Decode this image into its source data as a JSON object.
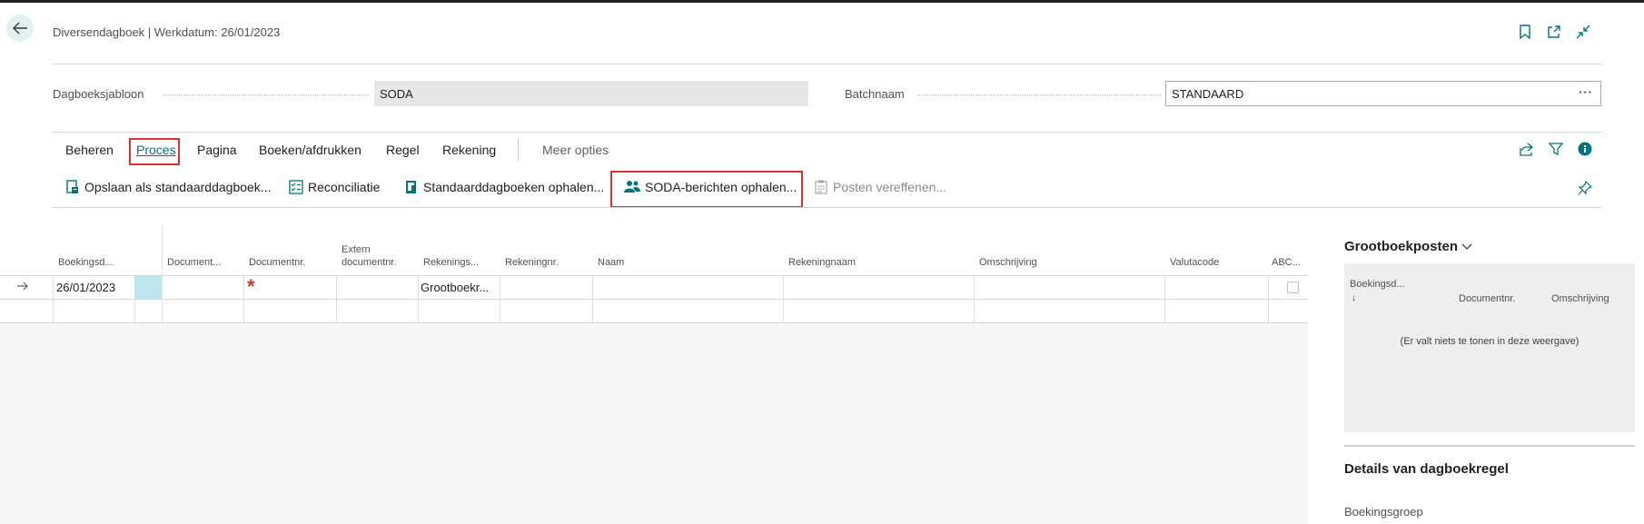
{
  "header": {
    "title": "Diversendagboek | Werkdatum: 26/01/2023"
  },
  "fields": {
    "template_label": "Dagboeksjabloon",
    "template_value": "SODA",
    "batch_label": "Batchnaam",
    "batch_value": "STANDAARD",
    "batch_more": "···"
  },
  "menu": {
    "items": [
      "Beheren",
      "Proces",
      "Pagina",
      "Boeken/afdrukken",
      "Regel",
      "Rekening"
    ],
    "active": "Proces",
    "more": "Meer opties"
  },
  "actions": [
    {
      "label": "Opslaan als standaarddagboek...",
      "icon": "save-template-icon"
    },
    {
      "label": "Reconciliatie",
      "icon": "checklist-icon"
    },
    {
      "label": "Standaarddagboeken ophalen...",
      "icon": "journal-icon"
    },
    {
      "label": "SODA-berichten ophalen...",
      "icon": "people-icon"
    },
    {
      "label": "Posten vereffenen...",
      "icon": "apply-entries-icon",
      "disabled": true
    }
  ],
  "grid": {
    "columns": [
      "Boekingsd...",
      "Document...",
      "Documentnr.",
      "Extern documentnr.",
      "Rekenings...",
      "Rekeningnr.",
      "Naam",
      "Rekeningnaam",
      "Omschrijving",
      "Valutacode",
      "ABC..."
    ],
    "rows": [
      {
        "posting_date": "26/01/2023",
        "account_type": "Grootboekr..."
      }
    ]
  },
  "factbox": {
    "title": "Grootboekposten",
    "col_posting": "Boekingsd...",
    "sort_arrow": "↓",
    "col_docno": "Documentnr.",
    "col_desc": "Omschrijving",
    "empty": "(Er valt niets te tonen in deze weergave)"
  },
  "details": {
    "title": "Details van dagboekregel",
    "field": "Boekingsgroep"
  },
  "colors": {
    "accent": "#00767a",
    "highlight": "#d9342b",
    "selected_cell": "#bfe6ee"
  }
}
